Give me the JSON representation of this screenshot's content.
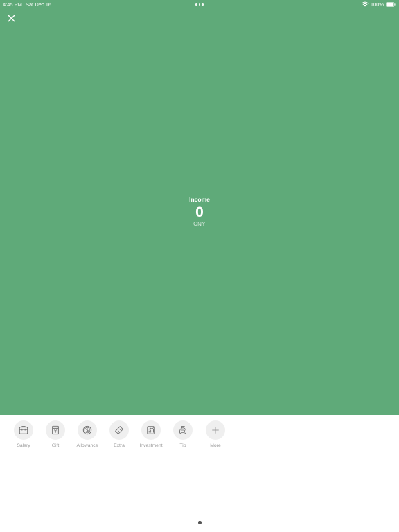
{
  "status_bar": {
    "time": "4:45 PM",
    "date": "Sat Dec 16",
    "battery": "100%",
    "icons": [
      "wifi-icon",
      "battery-icon"
    ]
  },
  "toolbar": {
    "close_icon": "close-icon"
  },
  "amount": {
    "label": "Income",
    "value": "0",
    "currency": "CNY"
  },
  "categories": [
    {
      "label": "Salary",
      "icon": "briefcase-icon"
    },
    {
      "label": "Gift",
      "icon": "gift-box-icon"
    },
    {
      "label": "Allowance",
      "icon": "coin-icon"
    },
    {
      "label": "Extra",
      "icon": "ticket-icon"
    },
    {
      "label": "Investment",
      "icon": "chart-icon"
    },
    {
      "label": "Tip",
      "icon": "money-bag-icon"
    },
    {
      "label": "More",
      "icon": "plus-icon"
    }
  ],
  "colors": {
    "accent_green": "#5faa79",
    "icon_circle": "#efefef",
    "label_gray": "#9a9a9a"
  },
  "pager": {
    "pages": 1,
    "current": 1
  }
}
